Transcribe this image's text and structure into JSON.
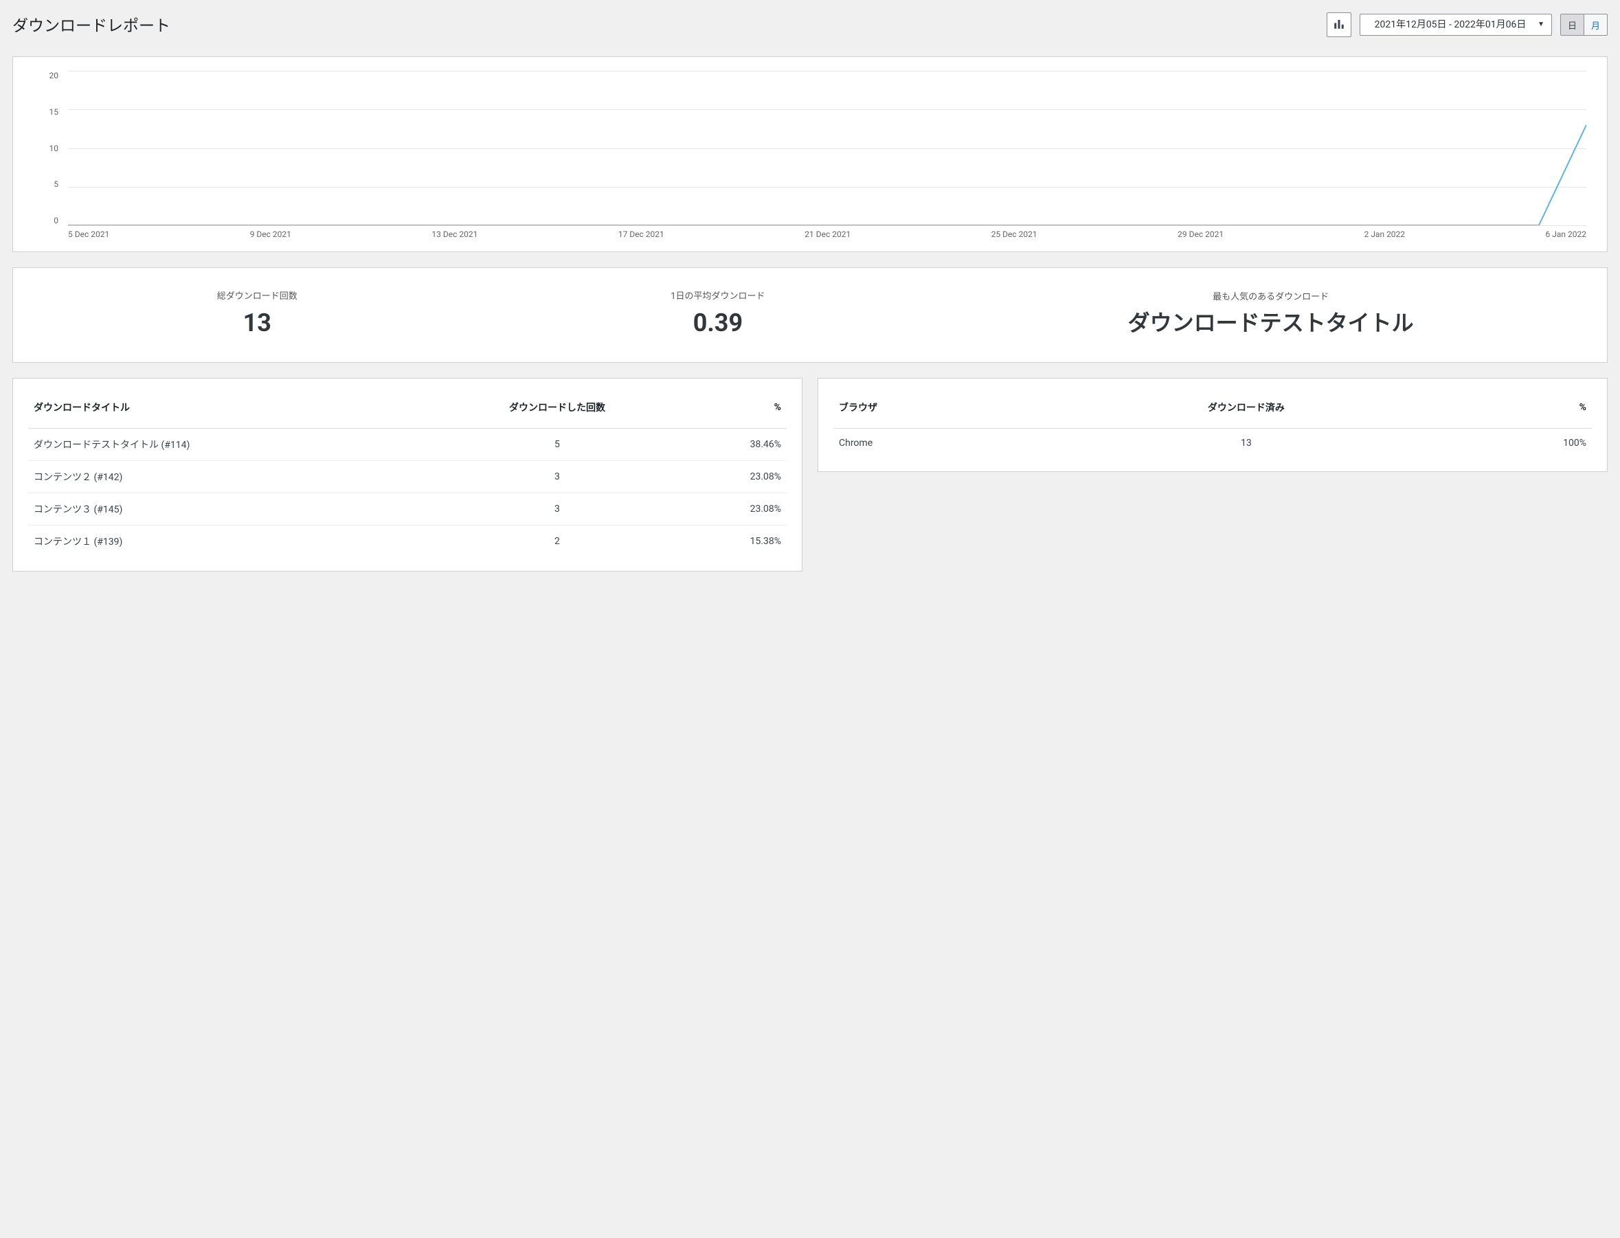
{
  "header": {
    "title": "ダウンロードレポート",
    "date_range": "2021年12月05日 - 2022年01月06日",
    "period_day": "日",
    "period_month": "月"
  },
  "chart_data": {
    "type": "line",
    "title": "",
    "xlabel": "",
    "ylabel": "",
    "ylim": [
      0,
      20
    ],
    "y_ticks": [
      0,
      5,
      10,
      15,
      20
    ],
    "x_tick_labels": [
      "5 Dec 2021",
      "9 Dec 2021",
      "13 Dec 2021",
      "17 Dec 2021",
      "21 Dec 2021",
      "25 Dec 2021",
      "29 Dec 2021",
      "2 Jan 2022",
      "6 Jan 2022"
    ],
    "x": [
      "2021-12-05",
      "2021-12-06",
      "2021-12-07",
      "2021-12-08",
      "2021-12-09",
      "2021-12-10",
      "2021-12-11",
      "2021-12-12",
      "2021-12-13",
      "2021-12-14",
      "2021-12-15",
      "2021-12-16",
      "2021-12-17",
      "2021-12-18",
      "2021-12-19",
      "2021-12-20",
      "2021-12-21",
      "2021-12-22",
      "2021-12-23",
      "2021-12-24",
      "2021-12-25",
      "2021-12-26",
      "2021-12-27",
      "2021-12-28",
      "2021-12-29",
      "2021-12-30",
      "2021-12-31",
      "2022-01-01",
      "2022-01-02",
      "2022-01-03",
      "2022-01-04",
      "2022-01-05",
      "2022-01-06"
    ],
    "series": [
      {
        "name": "downloads",
        "color": "#5cb3e8",
        "values": [
          0,
          0,
          0,
          0,
          0,
          0,
          0,
          0,
          0,
          0,
          0,
          0,
          0,
          0,
          0,
          0,
          0,
          0,
          0,
          0,
          0,
          0,
          0,
          0,
          0,
          0,
          0,
          0,
          0,
          0,
          0,
          0,
          13
        ]
      }
    ]
  },
  "summary": {
    "total_label": "総ダウンロード回数",
    "total_value": "13",
    "avg_label": "1日の平均ダウンロード",
    "avg_value": "0.39",
    "popular_label": "最も人気のあるダウンロード",
    "popular_value": "ダウンロードテストタイトル"
  },
  "titles_table": {
    "columns": {
      "title": "ダウンロードタイトル",
      "count": "ダウンロードした回数",
      "pct": "%"
    },
    "rows": [
      {
        "title": "ダウンロードテストタイトル (#114)",
        "count": "5",
        "pct": "38.46%"
      },
      {
        "title": "コンテンツ２ (#142)",
        "count": "3",
        "pct": "23.08%"
      },
      {
        "title": "コンテンツ３ (#145)",
        "count": "3",
        "pct": "23.08%"
      },
      {
        "title": "コンテンツ１ (#139)",
        "count": "2",
        "pct": "15.38%"
      }
    ]
  },
  "browser_table": {
    "columns": {
      "browser": "ブラウザ",
      "count": "ダウンロード済み",
      "pct": "%"
    },
    "rows": [
      {
        "browser": "Chrome",
        "count": "13",
        "pct": "100%"
      }
    ]
  }
}
